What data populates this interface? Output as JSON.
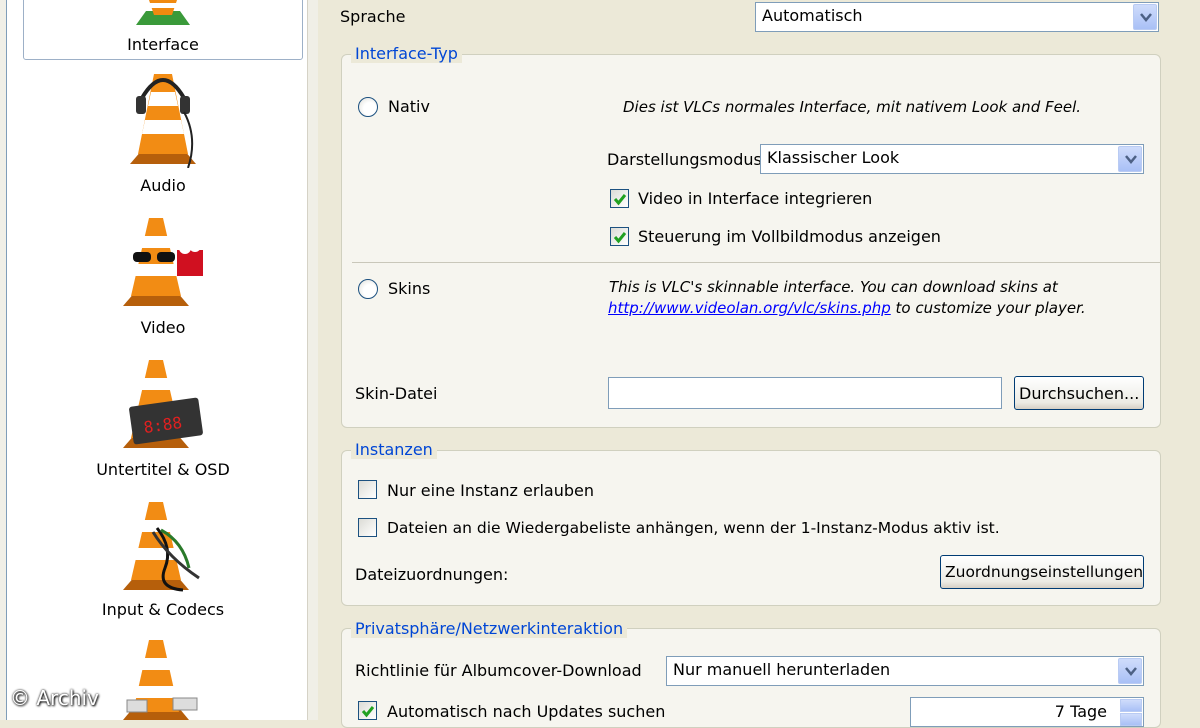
{
  "sidebar": {
    "categories": [
      {
        "label": "Interface",
        "icon": "interface-cone-icon"
      },
      {
        "label": "Audio",
        "icon": "audio-cone-icon"
      },
      {
        "label": "Video",
        "icon": "video-cone-icon"
      },
      {
        "label": "Untertitel & OSD",
        "icon": "subtitle-cone-icon"
      },
      {
        "label": "Input & Codecs",
        "icon": "codec-cone-icon"
      },
      {
        "label": "",
        "icon": "hotkeys-cone-icon"
      }
    ]
  },
  "watermark": "© Archiv",
  "language": {
    "label": "Sprache",
    "value": "Automatisch"
  },
  "interface_type": {
    "legend": "Interface-Typ",
    "native_label": "Nativ",
    "native_desc": "Dies ist VLCs normales Interface, mit nativem Look and Feel.",
    "display_mode_label": "Darstellungsmodus",
    "display_mode_value": "Klassischer Look",
    "embed_video_label": "Video in Interface integrieren",
    "fullscreen_controls_label": "Steuerung im Vollbildmodus anzeigen",
    "skins_label": "Skins",
    "skins_desc_1": "This is VLC's skinnable interface. You can download skins at",
    "skins_link": "http://www.videolan.org/vlc/skins.php",
    "skins_desc_2": " to customize your player.",
    "skin_file_label": "Skin-Datei",
    "skin_file_value": "",
    "browse_label": "Durchsuchen..."
  },
  "instances": {
    "legend": "Instanzen",
    "one_instance_label": "Nur eine Instanz erlauben",
    "enqueue_label": "Dateien an die Wiedergabeliste anhängen, wenn der 1-Instanz-Modus aktiv ist.",
    "file_assoc_label": "Dateizuordnungen:",
    "assoc_button_label": "Zuordnungseinstellungen"
  },
  "privacy": {
    "legend": "Privatsphäre/Netzwerkinteraktion",
    "album_art_label": "Richtlinie für Albumcover-Download",
    "album_art_value": "Nur manuell herunterladen",
    "updates_label": "Automatisch nach Updates suchen",
    "updates_interval": "7 Tage"
  },
  "colors": {
    "legend_blue": "#0046d5",
    "xp_bg": "#ece9d8",
    "check_green": "#21a121"
  }
}
